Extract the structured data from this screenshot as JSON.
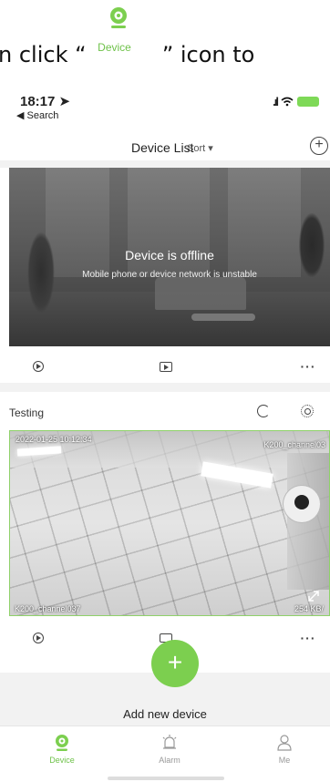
{
  "banner": {
    "text_before": "n click “",
    "inline_label": "Device",
    "text_after": "” icon to"
  },
  "status_bar": {
    "time": "18:17",
    "back": "Search"
  },
  "nav": {
    "title": "Device List",
    "sort": "Sort"
  },
  "device1": {
    "offline_title": "Device is offline",
    "offline_sub": "Mobile phone or device network is unstable"
  },
  "device2": {
    "name": "Testing",
    "timestamp": "2022-01-25 10:12:34",
    "channel_top": "K200_channel03",
    "channel_bottom": "K200_channel037",
    "bitrate": "254 KB/"
  },
  "add_device": {
    "label": "Add new device",
    "plus": "+"
  },
  "tabs": [
    {
      "label": "Device"
    },
    {
      "label": "Alarm"
    },
    {
      "label": "Me"
    }
  ],
  "colors": {
    "accent": "#7ccf4f",
    "tab_active": "#6fc24a"
  },
  "icons": [
    "device-icon",
    "add-icon",
    "play-icon",
    "playback-icon",
    "more-icon",
    "replay-icon",
    "gear-icon",
    "expand-icon",
    "screen-icon",
    "alarm-icon",
    "person-icon"
  ]
}
